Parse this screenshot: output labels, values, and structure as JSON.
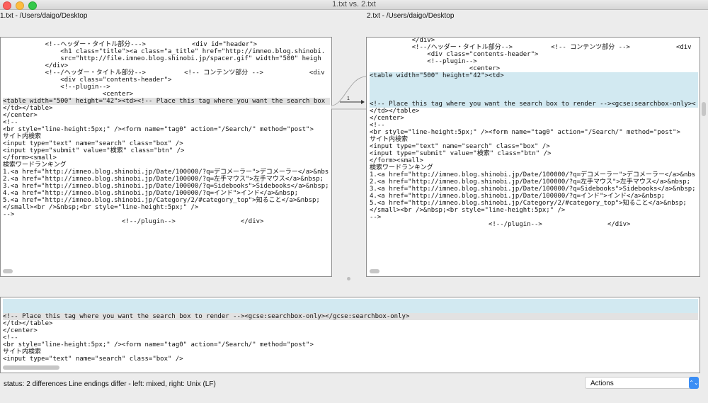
{
  "window": {
    "title": "1.txt vs. 2.txt"
  },
  "left": {
    "header": "1.txt - /Users/daigo/Desktop",
    "lines": [
      {
        "text": "           <!--ヘッダー・タイトル部分--->            <div id=\"header\">",
        "hl": ""
      },
      {
        "text": "               <h1 class=\"title\"><a class=\"a_title\" href=\"http://imneo.blog.shinobi.",
        "hl": ""
      },
      {
        "text": "               src=\"http://file.imneo.blog.shinobi.jp/spacer.gif\" width=\"500\" heigh",
        "hl": ""
      },
      {
        "text": "           </div>",
        "hl": ""
      },
      {
        "text": "           <!--/ヘッダー・タイトル部分-->          <!-- コンテンツ部分 -->            <div",
        "hl": ""
      },
      {
        "text": "               <div class=\"contents-header\">",
        "hl": ""
      },
      {
        "text": "               <!--plugin-->",
        "hl": ""
      },
      {
        "text": "                          <center>",
        "hl": ""
      },
      {
        "text": "<table width=\"500\" height=\"42\"><td><!-- Place this tag where you want the search box",
        "hl": "gray"
      },
      {
        "text": "</td></table>",
        "hl": ""
      },
      {
        "text": "</center>",
        "hl": ""
      },
      {
        "text": "<!--",
        "hl": ""
      },
      {
        "text": "<br style=\"line-height:5px;\" /><form name=\"tag0\" action=\"/Search/\" method=\"post\">",
        "hl": ""
      },
      {
        "text": "サイト内検索",
        "hl": ""
      },
      {
        "text": "<input type=\"text\" name=\"search\" class=\"box\" />",
        "hl": ""
      },
      {
        "text": "<input type=\"submit\" value=\"検索\" class=\"btn\" />",
        "hl": ""
      },
      {
        "text": "</form><small>",
        "hl": ""
      },
      {
        "text": "検索ワードランキング",
        "hl": ""
      },
      {
        "text": "1.<a href=\"http://imneo.blog.shinobi.jp/Date/100000/?q=デコメーラー\">デコメーラー</a>&nbs",
        "hl": ""
      },
      {
        "text": "2.<a href=\"http://imneo.blog.shinobi.jp/Date/100000/?q=左手マウス\">左手マウス</a>&nbsp;",
        "hl": ""
      },
      {
        "text": "3.<a href=\"http://imneo.blog.shinobi.jp/Date/100000/?q=Sidebooks\">Sidebooks</a>&nbsp;",
        "hl": ""
      },
      {
        "text": "4.<a href=\"http://imneo.blog.shinobi.jp/Date/100000/?q=インド\">インド</a>&nbsp;",
        "hl": ""
      },
      {
        "text": "5.<a href=\"http://imneo.blog.shinobi.jp/Category/2/#category_top\">知ること</a>&nbsp;",
        "hl": ""
      },
      {
        "text": "</small><br />&nbsp;<br style=\"line-height:5px;\" />",
        "hl": ""
      },
      {
        "text": "-->",
        "hl": ""
      },
      {
        "text": "                               <!--/plugin-->                 </div>",
        "hl": ""
      }
    ]
  },
  "right": {
    "header": "2.txt - /Users/daigo/Desktop",
    "lines": [
      {
        "text": "           </div>",
        "hl": ""
      },
      {
        "text": "           <!--/ヘッダー・タイトル部分-->          <!-- コンテンツ部分 -->            <div",
        "hl": ""
      },
      {
        "text": "               <div class=\"contents-header\">",
        "hl": ""
      },
      {
        "text": "               <!--plugin-->",
        "hl": ""
      },
      {
        "text": "                          <center>",
        "hl": ""
      },
      {
        "text": "<table width=\"500\" height=\"42\"><td>",
        "hl": "blue"
      },
      {
        "text": "",
        "hl": "blue"
      },
      {
        "text": "",
        "hl": "blue"
      },
      {
        "text": "",
        "hl": "blue"
      },
      {
        "text": "<!-- Place this tag where you want the search box to render --><gcse:searchbox-only><",
        "hl": "blue"
      },
      {
        "text": "</td></table>",
        "hl": ""
      },
      {
        "text": "</center>",
        "hl": ""
      },
      {
        "text": "<!--",
        "hl": ""
      },
      {
        "text": "<br style=\"line-height:5px;\" /><form name=\"tag0\" action=\"/Search/\" method=\"post\">",
        "hl": ""
      },
      {
        "text": "サイト内検索",
        "hl": ""
      },
      {
        "text": "<input type=\"text\" name=\"search\" class=\"box\" />",
        "hl": ""
      },
      {
        "text": "<input type=\"submit\" value=\"検索\" class=\"btn\" />",
        "hl": ""
      },
      {
        "text": "</form><small>",
        "hl": ""
      },
      {
        "text": "検索ワードランキング",
        "hl": ""
      },
      {
        "text": "1.<a href=\"http://imneo.blog.shinobi.jp/Date/100000/?q=デコメーラー\">デコメーラー</a>&nbs",
        "hl": ""
      },
      {
        "text": "2.<a href=\"http://imneo.blog.shinobi.jp/Date/100000/?q=左手マウス\">左手マウス</a>&nbsp;",
        "hl": ""
      },
      {
        "text": "3.<a href=\"http://imneo.blog.shinobi.jp/Date/100000/?q=Sidebooks\">Sidebooks</a>&nbsp;",
        "hl": ""
      },
      {
        "text": "4.<a href=\"http://imneo.blog.shinobi.jp/Date/100000/?q=インド\">インド</a>&nbsp;",
        "hl": ""
      },
      {
        "text": "5.<a href=\"http://imneo.blog.shinobi.jp/Category/2/#category_top\">知ること</a>&nbsp;",
        "hl": ""
      },
      {
        "text": "</small><br />&nbsp;<br style=\"line-height:5px;\" />",
        "hl": ""
      },
      {
        "text": "-->",
        "hl": ""
      },
      {
        "text": "                               <!--/plugin-->                 </div>",
        "hl": ""
      }
    ]
  },
  "gutter": {
    "diff_number": "1"
  },
  "merge": {
    "lines": [
      {
        "text": "",
        "hl": "blue"
      },
      {
        "text": "",
        "hl": "blue"
      },
      {
        "text": "<!-- Place this tag where you want the search box to render --><gcse:searchbox-only></gcse:searchbox-only>",
        "hl": "gray"
      },
      {
        "text": "</td></table>",
        "hl": ""
      },
      {
        "text": "</center>",
        "hl": ""
      },
      {
        "text": "<!--",
        "hl": ""
      },
      {
        "text": "<br style=\"line-height:5px;\" /><form name=\"tag0\" action=\"/Search/\" method=\"post\">",
        "hl": ""
      },
      {
        "text": "サイト内検索",
        "hl": ""
      },
      {
        "text": "<input type=\"text\" name=\"search\" class=\"box\" />",
        "hl": ""
      }
    ]
  },
  "status": {
    "text": "status:  2 differences   Line endings differ - left: mixed,  right: Unix (LF)"
  },
  "actions": {
    "label": "Actions"
  },
  "colors": {
    "changed_gray": "#e2e2e2",
    "changed_blue": "#d2e9f1",
    "accent": "#3b8ef5"
  }
}
